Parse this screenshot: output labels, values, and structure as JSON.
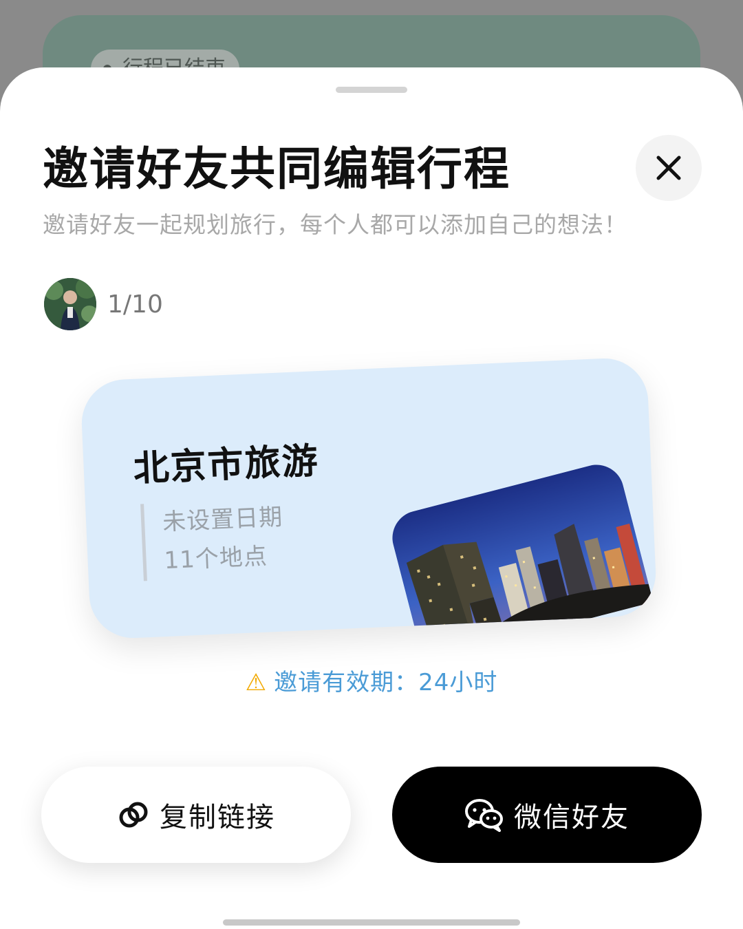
{
  "background": {
    "chip_label": "行程已结束"
  },
  "sheet": {
    "title": "邀请好友共同编辑行程",
    "subtitle": "邀请好友一起规划旅行，每个人都可以添加自己的想法！",
    "member_count": "1/10",
    "trip": {
      "title": "北京市旅游",
      "date": "未设置日期",
      "places": "11个地点"
    },
    "validity": "邀请有效期：24小时",
    "buttons": {
      "copy_link": "复制链接",
      "wechat": "微信好友"
    }
  },
  "colors": {
    "card_bg": "#dcecfb",
    "accent_blue": "#4a9bd6",
    "warning": "#f2a900"
  },
  "icons": [
    "close-icon",
    "warning-icon",
    "link-icon",
    "wechat-icon"
  ]
}
